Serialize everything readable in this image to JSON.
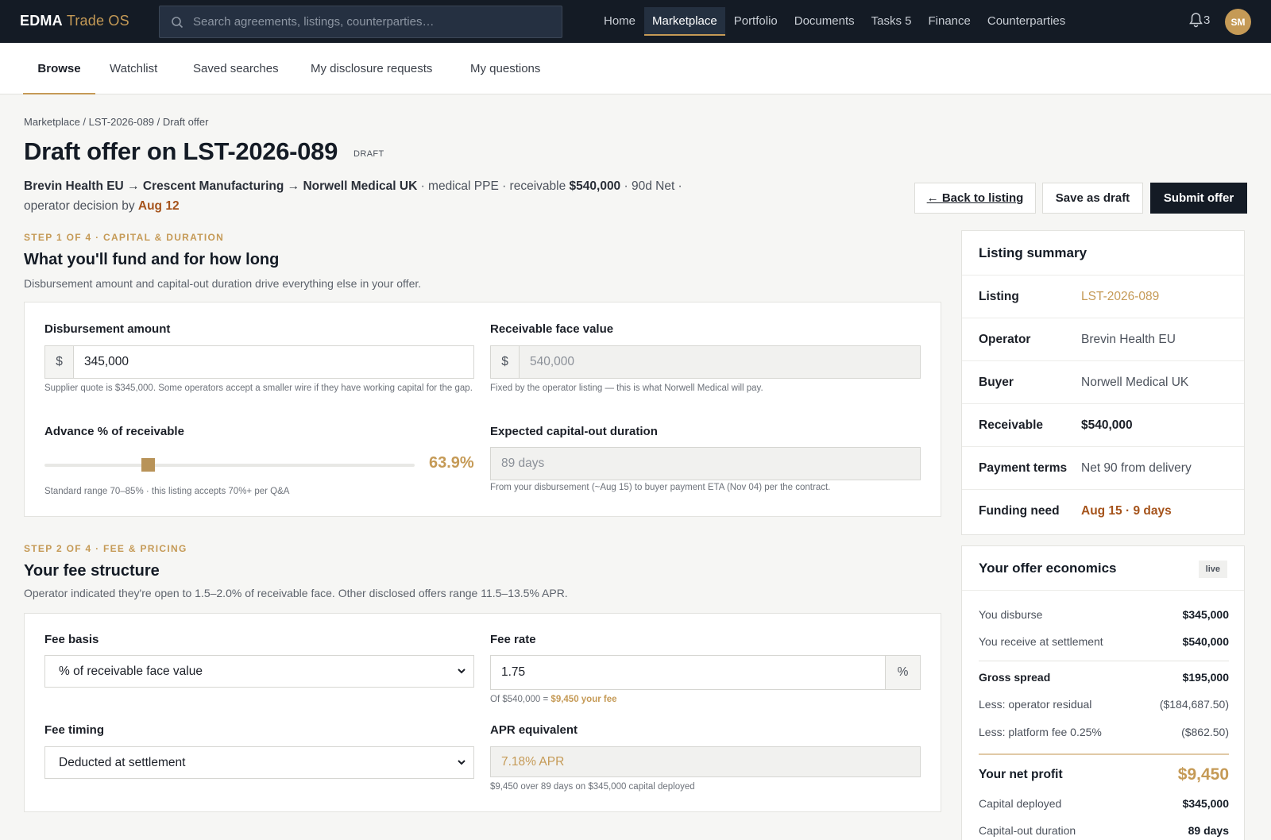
{
  "topbar": {
    "brand": "EDMA",
    "brand_accent": "Trade OS",
    "search_placeholder": "Search agreements, listings, counterparties…",
    "nav": [
      "Home",
      "Marketplace",
      "Portfolio",
      "Documents",
      "Tasks 5",
      "Finance",
      "Counterparties"
    ],
    "active_nav": "Marketplace",
    "notifications_count": "3",
    "avatar_initials": "SM"
  },
  "subnav": {
    "tabs": [
      "Browse",
      "Watchlist",
      "Saved searches",
      "My disclosure requests",
      "My questions"
    ],
    "active_tab": "Browse"
  },
  "page": {
    "breadcrumb": "Marketplace / LST-2026-089 / Draft offer",
    "title": "Draft offer on LST-2026-089",
    "status_badge": "DRAFT",
    "meta": {
      "operator": "Brevin Health EU",
      "arrow1": "→",
      "supplier": "Crescent Manufacturing",
      "arrow2": "→",
      "buyer": "Norwell Medical UK",
      "sector": " · medical PPE · receivable ",
      "amount": "$540,000",
      "terms": " · 90d Net · ",
      "decision_prefix": "operator decision by ",
      "decision_date": "Aug 12"
    },
    "actions": {
      "back": "← Back to listing",
      "save": "Save as draft",
      "submit": "Submit offer"
    }
  },
  "step1": {
    "label": "STEP 1 OF 4 · CAPITAL & DURATION",
    "title": "What you'll fund and for how long",
    "description": "Disbursement amount and capital-out duration drive everything else in your offer.",
    "disbursement_label": "Disbursement amount",
    "disbursement_prefix": "$",
    "disbursement_value": "345,000",
    "disbursement_help": "Supplier quote is $345,000. Some operators accept a smaller wire if they have working capital for the gap.",
    "face_label": "Receivable face value",
    "face_prefix": "$",
    "face_value": "540,000",
    "face_help": "Fixed by the operator listing — this is what Norwell Medical will pay.",
    "advance_label": "Advance % of receivable",
    "advance_value": "63.9%",
    "advance_fraction": 0.639,
    "advance_help": "Standard range 70–85% · this listing accepts 70%+ per Q&A",
    "duration_label": "Expected capital-out duration",
    "duration_value": "89 days",
    "duration_help": "From your disbursement (~Aug 15) to buyer payment ETA (Nov 04) per the contract."
  },
  "step2": {
    "label": "STEP 2 OF 4 · FEE & PRICING",
    "title": "Your fee structure",
    "description": "Operator indicated they're open to 1.5–2.0% of receivable face. Other disclosed offers range 11.5–13.5% APR.",
    "fee_basis_label": "Fee basis",
    "fee_basis_value": "% of receivable face value",
    "fee_rate_label": "Fee rate",
    "fee_rate_value": "1.75",
    "fee_rate_suffix": "%",
    "fee_rate_help_prefix": "Of $540,000 = ",
    "fee_rate_help_fee": "$9,450 your fee",
    "fee_timing_label": "Fee timing",
    "fee_timing_value": "Deducted at settlement",
    "apr_label": "APR equivalent",
    "apr_value": "7.18% APR",
    "apr_help": "$9,450 over 89 days on $345,000 capital deployed"
  },
  "listing_summary": {
    "title": "Listing summary",
    "rows": [
      {
        "k": "Listing",
        "v": "LST-2026-089"
      },
      {
        "k": "Operator",
        "v": "Brevin Health EU"
      },
      {
        "k": "Buyer",
        "v": "Norwell Medical UK"
      },
      {
        "k": "Receivable",
        "v": "$540,000"
      },
      {
        "k": "Payment terms",
        "v": "Net 90 from delivery"
      },
      {
        "k": "Funding need",
        "v": "Aug 15 · 9 days"
      }
    ]
  },
  "economics": {
    "title": "Your offer economics",
    "badge": "live",
    "you_disburse_k": "You disburse",
    "you_disburse_v": "$345,000",
    "receive_k": "You receive at settlement",
    "receive_v": "$540,000",
    "spread_k": "Gross spread",
    "spread_v": "$195,000",
    "residual_k": "Less: operator residual",
    "residual_v": "($184,687.50)",
    "platform_k": "Less: platform fee 0.25%",
    "platform_v": "($862.50)",
    "profit_k": "Your net profit",
    "profit_v": "$9,450",
    "capital_k": "Capital deployed",
    "capital_v": "$345,000",
    "duration_k": "Capital-out duration",
    "duration_v": "89 days"
  },
  "colors": {
    "accent": "#c59a56",
    "header_bg": "#141b25",
    "alert": "#a5531b"
  }
}
